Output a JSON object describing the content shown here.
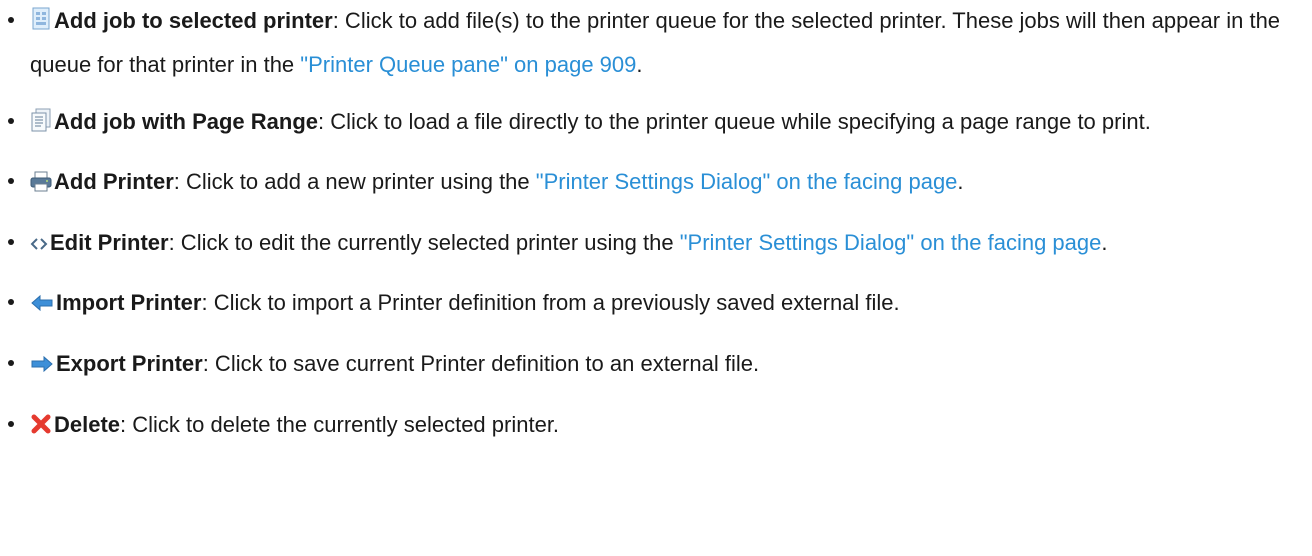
{
  "items": [
    {
      "icon": "add-job-document-icon",
      "term": "Add job to selected printer",
      "text": ": Click to add file(s) to the printer queue for the selected printer. These jobs will then appear in the queue for that printer in the ",
      "link": "\"Printer Queue pane\" on page 909",
      "after": "."
    },
    {
      "icon": "add-job-page-range-icon",
      "term": "Add job with Page Range",
      "text": ": Click to load a file directly to the printer queue while specifying a page range to print.",
      "link": "",
      "after": ""
    },
    {
      "icon": "printer-icon",
      "term": "Add Printer",
      "text": ": Click to add a new printer using the ",
      "link": "\"Printer Settings Dialog\" on the facing page",
      "after": "."
    },
    {
      "icon": "edit-code-icon",
      "term": "Edit Printer",
      "text": ": Click to edit the currently selected printer using the ",
      "link": "\"Printer Settings Dialog\" on the facing page",
      "after": "."
    },
    {
      "icon": "import-arrow-left-icon",
      "term": "Import Printer",
      "text": ": Click to import a Printer definition from a previously saved external file.",
      "link": "",
      "after": ""
    },
    {
      "icon": "export-arrow-right-icon",
      "term": "Export Printer",
      "text": ": Click to save current Printer definition to an external file.",
      "link": "",
      "after": ""
    },
    {
      "icon": "delete-x-icon",
      "term": "Delete",
      "text": ": Click to delete the currently selected printer.",
      "link": "",
      "after": ""
    }
  ],
  "colors": {
    "link": "#2a8fd6",
    "text": "#1a1a1a",
    "delete_icon": "#e53a2f",
    "arrow_icon": "#3d8fd8"
  }
}
